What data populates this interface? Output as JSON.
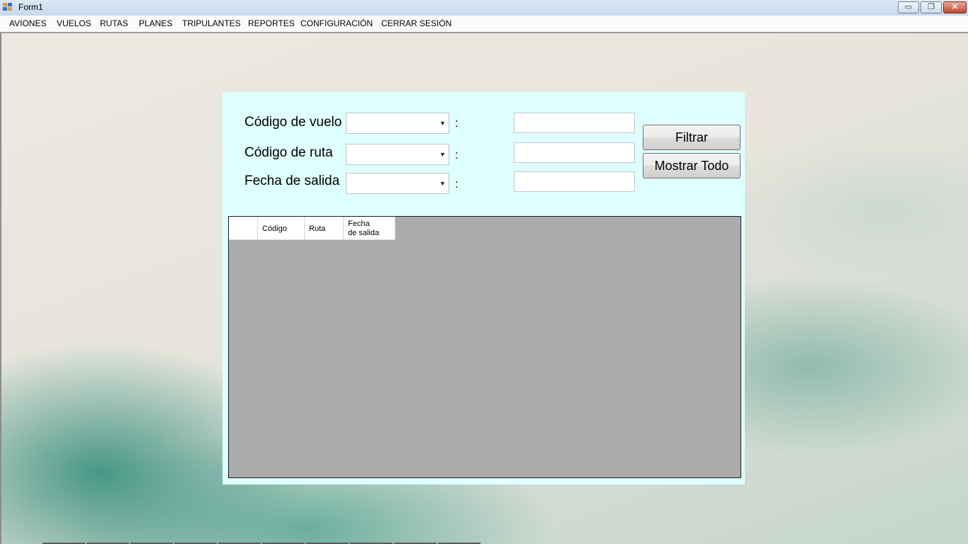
{
  "window": {
    "title": "Form1",
    "controls": {
      "minimize": "▭",
      "restore": "❐",
      "close": "✕"
    }
  },
  "menu": {
    "items": [
      {
        "label": "AVIONES"
      },
      {
        "label": "VUELOS"
      },
      {
        "label": "RUTAS"
      },
      {
        "label": "PLANES"
      },
      {
        "label": "TRIPULANTES"
      },
      {
        "label": "REPORTES"
      },
      {
        "label": "CONFIGURACIÓN"
      },
      {
        "label": "CERRAR SESIÓN"
      }
    ]
  },
  "filter": {
    "rows": [
      {
        "label": "Código de vuelo",
        "combo_value": "",
        "separator": ":",
        "text_value": ""
      },
      {
        "label": "Código de ruta",
        "combo_value": "",
        "separator": ":",
        "text_value": ""
      },
      {
        "label": "Fecha de salida",
        "combo_value": "",
        "separator": ":",
        "text_value": ""
      }
    ],
    "filter_button": "Filtrar",
    "show_all_button": "Mostrar Todo"
  },
  "grid": {
    "columns": [
      {
        "label": ""
      },
      {
        "label": "Código"
      },
      {
        "label": "Ruta"
      },
      {
        "label": "Fecha\nde salida"
      }
    ],
    "rows": []
  },
  "colors": {
    "panel_bg": "#e0ffff",
    "grid_bg": "#ababab"
  }
}
